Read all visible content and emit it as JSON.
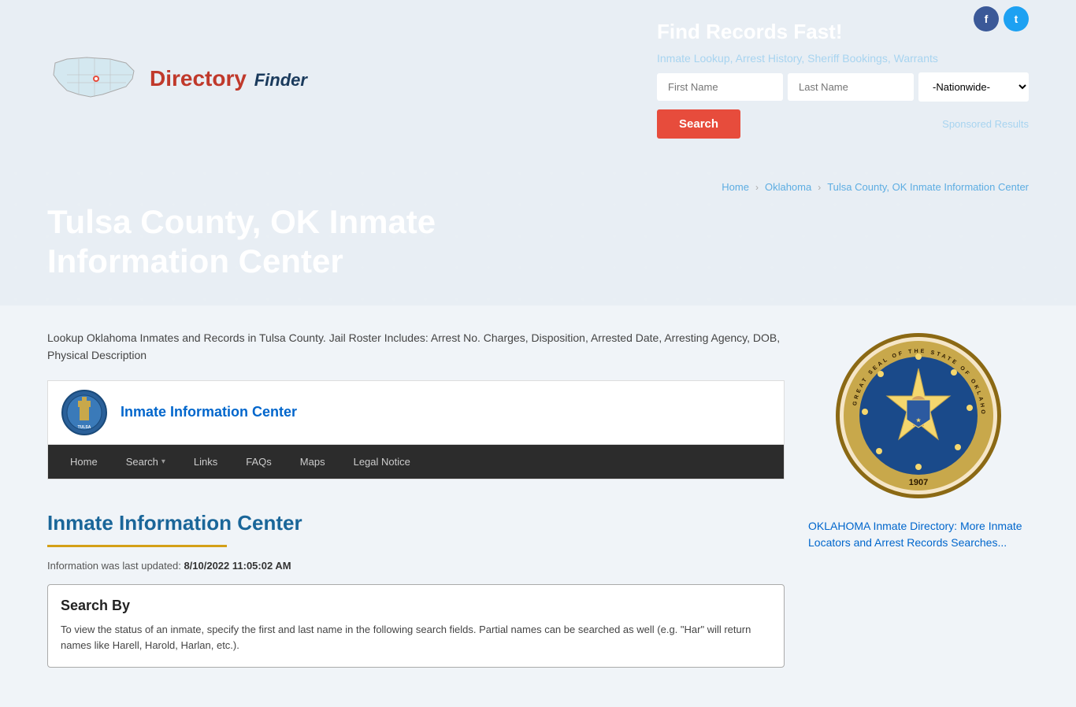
{
  "social": {
    "facebook_label": "f",
    "twitter_label": "t"
  },
  "header": {
    "logo_text_directory": "Directory",
    "logo_text_finder": "Finder",
    "find_records_title": "Find Records Fast!",
    "find_records_sub": "Inmate Lookup, Arrest History, Sheriff Bookings, Warrants",
    "first_name_placeholder": "First Name",
    "last_name_placeholder": "Last Name",
    "nationwide_default": "-Nationwide-",
    "search_button_label": "Search",
    "sponsored_text": "Sponsored Results"
  },
  "page_title": {
    "title_line1": "Tulsa County, OK Inmate",
    "title_line2": "Information Center"
  },
  "breadcrumb": {
    "home": "Home",
    "oklahoma": "Oklahoma",
    "current": "Tulsa County, OK Inmate Information Center"
  },
  "content": {
    "intro": "Lookup Oklahoma Inmates and Records in Tulsa County. Jail Roster Includes: Arrest No. Charges, Disposition, Arrested Date, Arresting Agency, DOB, Physical Description",
    "inmate_widget_title": "Inmate Information Center",
    "nav_home": "Home",
    "nav_search": "Search",
    "nav_links": "Links",
    "nav_faqs": "FAQs",
    "nav_maps": "Maps",
    "nav_legal": "Legal Notice",
    "iic_heading": "Inmate Information Center",
    "last_updated_label": "Information was last updated: ",
    "last_updated_value": "8/10/2022 11:05:02 AM",
    "search_by_title": "Search By",
    "search_by_text": "To view the status of an inmate, specify the first and last name in the following search fields. Partial names can be searched as well (e.g. \"Har\" will return names like Harell, Harold, Harlan, etc.)."
  },
  "sidebar": {
    "seal_year": "1907",
    "ok_directory_text": "OKLAHOMA Inmate Directory: More Inmate Locators and Arrest Records Searches..."
  }
}
